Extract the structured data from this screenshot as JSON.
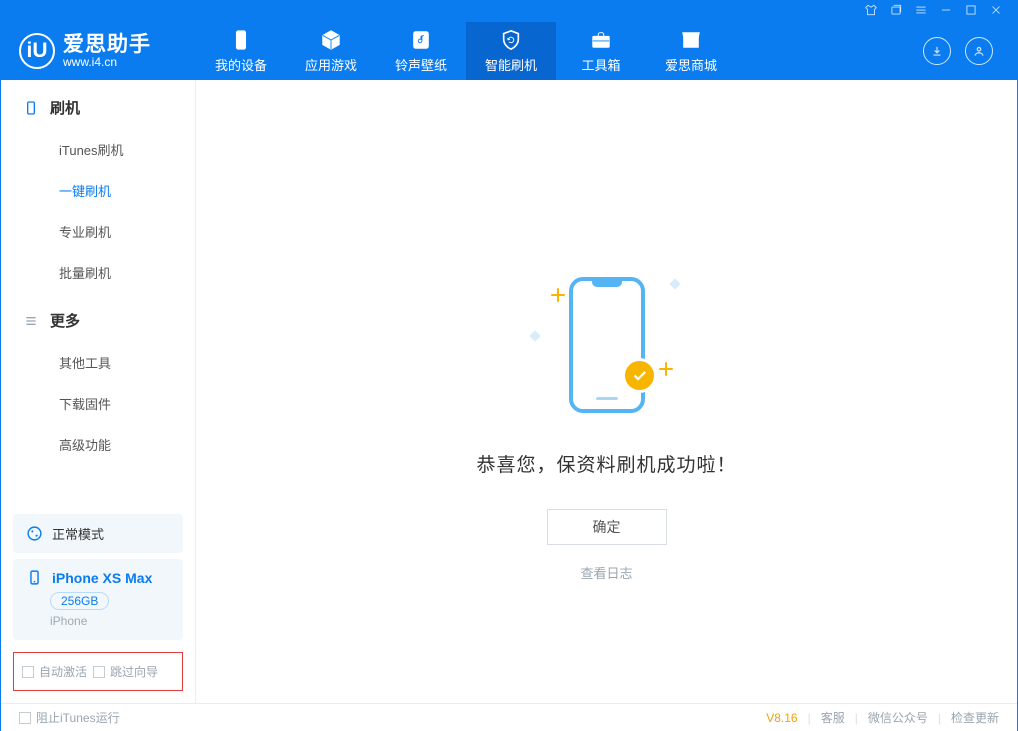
{
  "app": {
    "title": "爱思助手",
    "subtitle": "www.i4.cn",
    "logo_letter": "iU"
  },
  "titlebar_icons": [
    "shirt-icon",
    "layers-icon",
    "menu-icon",
    "minimize",
    "maximize",
    "close"
  ],
  "nav": {
    "tabs": [
      {
        "label": "我的设备",
        "icon": "device-icon"
      },
      {
        "label": "应用游戏",
        "icon": "cube-icon"
      },
      {
        "label": "铃声壁纸",
        "icon": "music-icon"
      },
      {
        "label": "智能刷机",
        "icon": "shield-refresh-icon",
        "active": true
      },
      {
        "label": "工具箱",
        "icon": "toolbox-icon"
      },
      {
        "label": "爱思商城",
        "icon": "store-icon"
      }
    ],
    "right_icons": [
      "download-circle-icon",
      "user-circle-icon"
    ]
  },
  "sidebar": {
    "section1": {
      "title": "刷机",
      "items": [
        "iTunes刷机",
        "一键刷机",
        "专业刷机",
        "批量刷机"
      ],
      "active_index": 1
    },
    "section2": {
      "title": "更多",
      "items": [
        "其他工具",
        "下载固件",
        "高级功能"
      ]
    },
    "mode_card": "正常模式",
    "device": {
      "name": "iPhone XS Max",
      "capacity": "256GB",
      "type": "iPhone"
    },
    "checks": {
      "auto_activate": "自动激活",
      "skip_guide": "跳过向导"
    }
  },
  "content": {
    "success_message": "恭喜您，保资料刷机成功啦！",
    "ok_button": "确定",
    "view_log": "查看日志"
  },
  "statusbar": {
    "block_itunes": "阻止iTunes运行",
    "version": "V8.16",
    "links": [
      "客服",
      "微信公众号",
      "检查更新"
    ]
  }
}
